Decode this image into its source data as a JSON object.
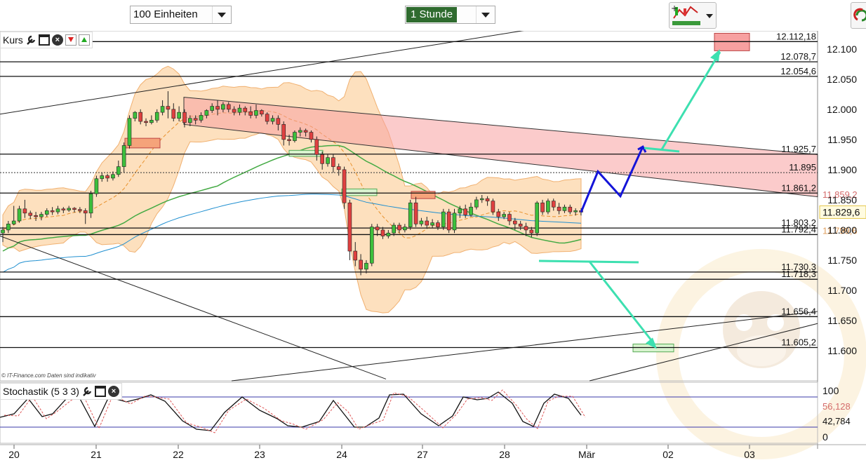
{
  "toolbar": {
    "units_value": "100 Einheiten",
    "interval_value": "1 Stunde"
  },
  "panels": {
    "price_label": "Kurs",
    "stoch_label": "Stochastik (5 3 3)"
  },
  "copyright": "© IT-Finance.com  Daten sind indikativ",
  "chart_data": {
    "type": "candlestick",
    "price_axis": {
      "min": 11550,
      "max": 12130,
      "ticks": [
        12100,
        12050,
        12000,
        11950,
        11900,
        11850,
        11800,
        11750,
        11700,
        11650,
        11600
      ]
    },
    "x_labels": [
      "20",
      "21",
      "22",
      "23",
      "24",
      "27",
      "28",
      "Mär",
      "02",
      "03"
    ],
    "levels": [
      {
        "value": 12112.18,
        "label": "12.112,18"
      },
      {
        "value": 12078.7,
        "label": "12.078,7"
      },
      {
        "value": 12054.6,
        "label": "12.054,6"
      },
      {
        "value": 11925.7,
        "label": "11.925,7"
      },
      {
        "value": 11861.2,
        "label": "11.861,2"
      },
      {
        "value": 11803.2,
        "label": "11.803,2"
      },
      {
        "value": 11792.4,
        "label": "11.792,4"
      },
      {
        "value": 11730.3,
        "label": "11.730,3"
      },
      {
        "value": 11718.3,
        "label": "11.718,3"
      },
      {
        "value": 11656.4,
        "label": "11.656,4"
      },
      {
        "value": 11605.2,
        "label": "11.605,2"
      }
    ],
    "dashed_level": {
      "value": 11895,
      "label": "11.895"
    },
    "last_price": {
      "value": 11829.6,
      "label": "11.829,6"
    },
    "indicator_readouts": [
      {
        "value": 11859.2,
        "label": "11.859,2",
        "color": "#d46b6b"
      },
      {
        "value": 11799.6,
        "label": "11.799,6",
        "color": "#e0a060"
      }
    ],
    "candles": [
      [
        11795,
        11800,
        11780,
        11805
      ],
      [
        11800,
        11810,
        11795,
        11815
      ],
      [
        11810,
        11815,
        11808,
        11840
      ],
      [
        11815,
        11835,
        11812,
        11840
      ],
      [
        11835,
        11828,
        11820,
        11850
      ],
      [
        11828,
        11824,
        11818,
        11832
      ],
      [
        11824,
        11822,
        11815,
        11830
      ],
      [
        11822,
        11826,
        11816,
        11830
      ],
      [
        11826,
        11832,
        11822,
        11836
      ],
      [
        11832,
        11830,
        11825,
        11838
      ],
      [
        11830,
        11835,
        11826,
        11840
      ],
      [
        11835,
        11833,
        11828,
        11838
      ],
      [
        11833,
        11836,
        11830,
        11840
      ],
      [
        11836,
        11834,
        11829,
        11838
      ],
      [
        11834,
        11832,
        11828,
        11838
      ],
      [
        11832,
        11828,
        11810,
        11836
      ],
      [
        11828,
        11860,
        11820,
        11865
      ],
      [
        11860,
        11885,
        11855,
        11890
      ],
      [
        11885,
        11890,
        11880,
        11895
      ],
      [
        11890,
        11886,
        11880,
        11893
      ],
      [
        11886,
        11892,
        11882,
        11897
      ],
      [
        11892,
        11905,
        11888,
        11915
      ],
      [
        11905,
        11940,
        11895,
        11945
      ],
      [
        11940,
        11985,
        11935,
        11990
      ],
      [
        11985,
        11995,
        11980,
        11997
      ],
      [
        11995,
        11980,
        11975,
        12000
      ],
      [
        11980,
        11978,
        11972,
        11985
      ],
      [
        11978,
        11982,
        11975,
        11990
      ],
      [
        11982,
        11995,
        11978,
        12000
      ],
      [
        11995,
        12005,
        11990,
        12015
      ],
      [
        12005,
        12000,
        11985,
        12030
      ],
      [
        12000,
        11985,
        11980,
        12010
      ],
      [
        11985,
        11995,
        11980,
        12005
      ],
      [
        11995,
        11978,
        11970,
        12000
      ],
      [
        11978,
        11985,
        11972,
        11990
      ],
      [
        11985,
        11982,
        11975,
        11990
      ],
      [
        11982,
        11990,
        11978,
        11995
      ],
      [
        11990,
        11998,
        11985,
        12000
      ],
      [
        11998,
        12005,
        11994,
        12010
      ],
      [
        12005,
        12000,
        11990,
        12015
      ],
      [
        12000,
        12008,
        11995,
        12012
      ],
      [
        12008,
        12000,
        11995,
        12012
      ],
      [
        12000,
        11995,
        11990,
        12005
      ],
      [
        11995,
        12002,
        11990,
        12008
      ],
      [
        12002,
        11996,
        11990,
        12005
      ],
      [
        11996,
        11990,
        11985,
        12005
      ],
      [
        11990,
        11998,
        11985,
        12008
      ],
      [
        11998,
        11992,
        11988,
        12000
      ],
      [
        11992,
        11980,
        11975,
        11995
      ],
      [
        11980,
        11985,
        11975,
        11990
      ],
      [
        11985,
        11975,
        11965,
        11990
      ],
      [
        11975,
        11950,
        11940,
        11980
      ],
      [
        11950,
        11948,
        11940,
        11958
      ],
      [
        11948,
        11962,
        11945,
        11965
      ],
      [
        11962,
        11965,
        11955,
        11970
      ],
      [
        11965,
        11962,
        11955,
        11968
      ],
      [
        11962,
        11950,
        11945,
        11965
      ],
      [
        11950,
        11925,
        11915,
        11955
      ],
      [
        11925,
        11910,
        11900,
        11930
      ],
      [
        11910,
        11920,
        11905,
        11925
      ],
      [
        11920,
        11905,
        11895,
        11925
      ],
      [
        11905,
        11900,
        11890,
        11910
      ],
      [
        11900,
        11845,
        11835,
        11905
      ],
      [
        11845,
        11765,
        11750,
        11850
      ],
      [
        11765,
        11750,
        11740,
        11780
      ],
      [
        11750,
        11735,
        11725,
        11760
      ],
      [
        11735,
        11745,
        11728,
        11750
      ],
      [
        11745,
        11805,
        11740,
        11810
      ],
      [
        11805,
        11800,
        11790,
        11810
      ],
      [
        11800,
        11790,
        11785,
        11805
      ],
      [
        11790,
        11795,
        11786,
        11800
      ],
      [
        11795,
        11808,
        11790,
        11812
      ],
      [
        11808,
        11800,
        11795,
        11812
      ],
      [
        11800,
        11805,
        11796,
        11810
      ],
      [
        11805,
        11845,
        11800,
        11850
      ],
      [
        11845,
        11810,
        11805,
        11855
      ],
      [
        11810,
        11815,
        11806,
        11820
      ],
      [
        11815,
        11808,
        11802,
        11822
      ],
      [
        11808,
        11812,
        11804,
        11818
      ],
      [
        11812,
        11805,
        11800,
        11816
      ],
      [
        11805,
        11830,
        11800,
        11835
      ],
      [
        11830,
        11800,
        11795,
        11835
      ],
      [
        11800,
        11828,
        11795,
        11835
      ],
      [
        11828,
        11835,
        11820,
        11840
      ],
      [
        11835,
        11825,
        11820,
        11842
      ],
      [
        11825,
        11838,
        11822,
        11845
      ],
      [
        11838,
        11850,
        11834,
        11855
      ],
      [
        11850,
        11852,
        11845,
        11858
      ],
      [
        11852,
        11848,
        11840,
        11856
      ],
      [
        11848,
        11830,
        11825,
        11852
      ],
      [
        11830,
        11822,
        11815,
        11835
      ],
      [
        11822,
        11826,
        11818,
        11830
      ],
      [
        11826,
        11815,
        11808,
        11830
      ],
      [
        11815,
        11810,
        11800,
        11820
      ],
      [
        11810,
        11806,
        11800,
        11815
      ],
      [
        11806,
        11800,
        11790,
        11812
      ],
      [
        11800,
        11795,
        11788,
        11805
      ],
      [
        11795,
        11845,
        11790,
        11848
      ],
      [
        11845,
        11830,
        11825,
        11850
      ],
      [
        11830,
        11848,
        11826,
        11852
      ],
      [
        11848,
        11838,
        11832,
        11852
      ],
      [
        11838,
        11832,
        11826,
        11845
      ],
      [
        11832,
        11838,
        11828,
        11842
      ],
      [
        11838,
        11830,
        11826,
        11842
      ],
      [
        11830,
        11832,
        11824,
        11836
      ],
      [
        11832,
        11829.6,
        11824,
        11836
      ]
    ],
    "forecast_path": [
      11829.6,
      11897,
      11856,
      11938
    ],
    "targets": {
      "upper": 12112.18,
      "lower": 11605.2
    },
    "stochastic": {
      "label": "Stochastik (5 3 3)",
      "axis": [
        "100",
        "0"
      ],
      "k_value": "56,128",
      "d_value": "42,784"
    }
  }
}
